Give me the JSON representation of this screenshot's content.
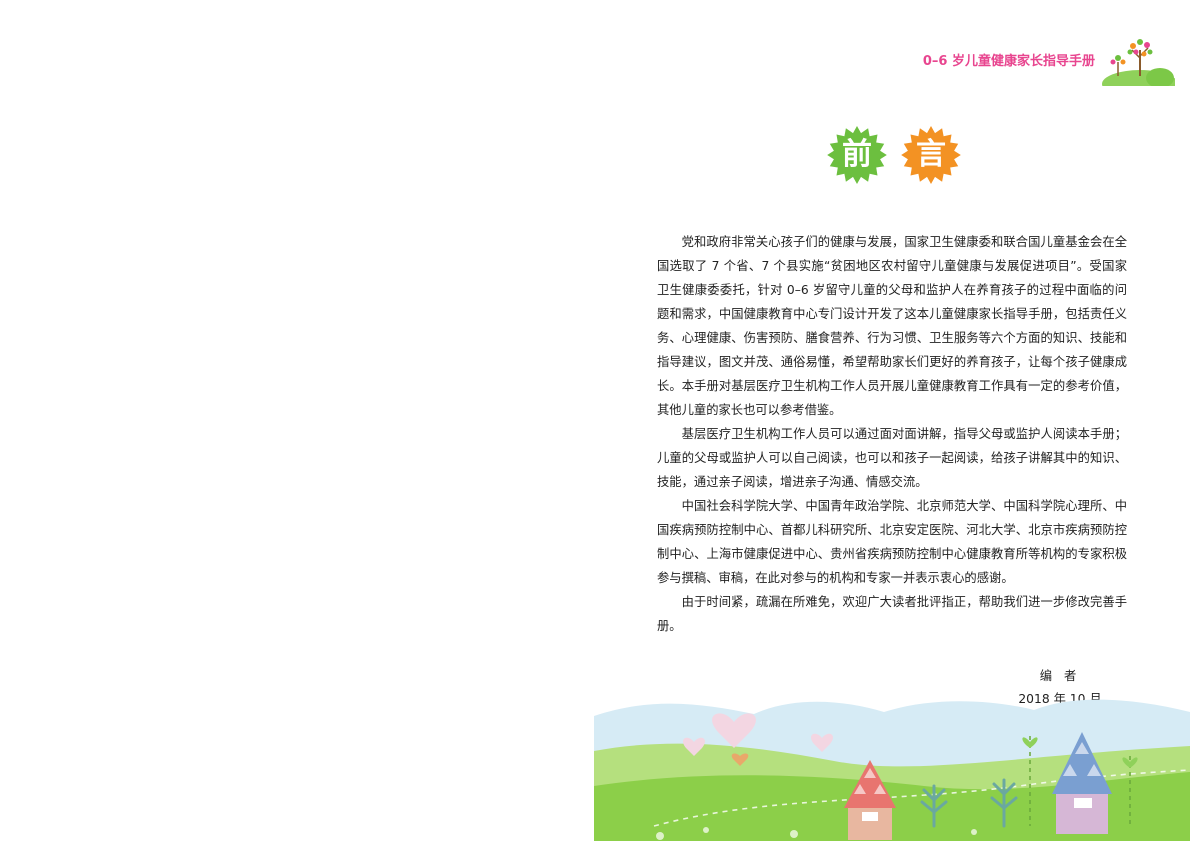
{
  "header": {
    "title": "0–6 岁儿童健康家长指导手册"
  },
  "heading": {
    "char1": "前",
    "char2": "言"
  },
  "colors": {
    "pink": "#e8458f",
    "green": "#6cbf3f",
    "orange": "#f39223",
    "grass": "#8fcf4a",
    "sky": "#cfe7f3"
  },
  "paragraphs": [
    "党和政府非常关心孩子们的健康与发展，国家卫生健康委和联合国儿童基金会在全国选取了 7 个省、7 个县实施“贫困地区农村留守儿童健康与发展促进项目”。受国家卫生健康委委托，针对 0–6 岁留守儿童的父母和监护人在养育孩子的过程中面临的问题和需求，中国健康教育中心专门设计开发了这本儿童健康家长指导手册，包括责任义务、心理健康、伤害预防、膳食营养、行为习惯、卫生服务等六个方面的知识、技能和指导建议，图文并茂、通俗易懂，希望帮助家长们更好的养育孩子，让每个孩子健康成长。本手册对基层医疗卫生机构工作人员开展儿童健康教育工作具有一定的参考价值，其他儿童的家长也可以参考借鉴。",
    "基层医疗卫生机构工作人员可以通过面对面讲解，指导父母或监护人阅读本手册；儿童的父母或监护人可以自己阅读，也可以和孩子一起阅读，给孩子讲解其中的知识、技能，通过亲子阅读，增进亲子沟通、情感交流。",
    "中国社会科学院大学、中国青年政治学院、北京师范大学、中国科学院心理所、中国疾病预防控制中心、首都儿科研究所、北京安定医院、河北大学、北京市疾病预防控制中心、上海市健康促进中心、贵州省疾病预防控制中心健康教育所等机构的专家积极参与撰稿、审稿，在此对参与的机构和专家一并表示衷心的感谢。",
    "由于时间紧，疏漏在所难免，欢迎广大读者批评指正，帮助我们进一步修改完善手册。"
  ],
  "signature": {
    "author": "编 者",
    "date": "2018 年 10 月"
  }
}
